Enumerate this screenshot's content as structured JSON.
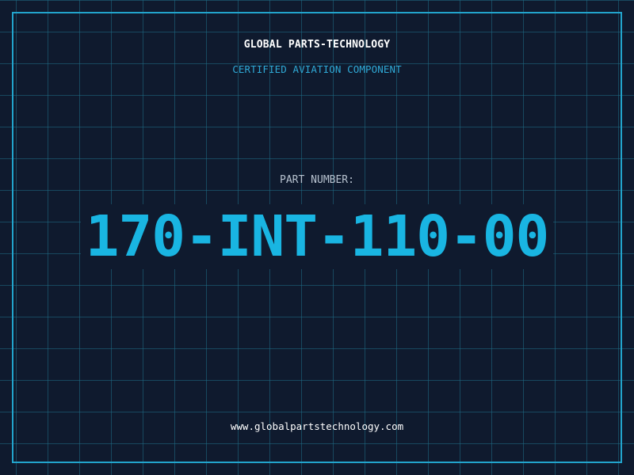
{
  "header": {
    "company": "GLOBAL PARTS-TECHNOLOGY",
    "subtitle": "CERTIFIED AVIATION COMPONENT"
  },
  "part": {
    "label": "PART NUMBER:",
    "number": "170-INT-110-00"
  },
  "footer": {
    "website": "www.globalpartstechnology.com"
  },
  "colors": {
    "background": "#0f1a2e",
    "grid": "#1e6e87",
    "frame": "#22a4cc",
    "accent": "#19b5e2",
    "subtitle": "#2fa9d6",
    "label": "#b7c2cf",
    "text": "#ffffff"
  }
}
